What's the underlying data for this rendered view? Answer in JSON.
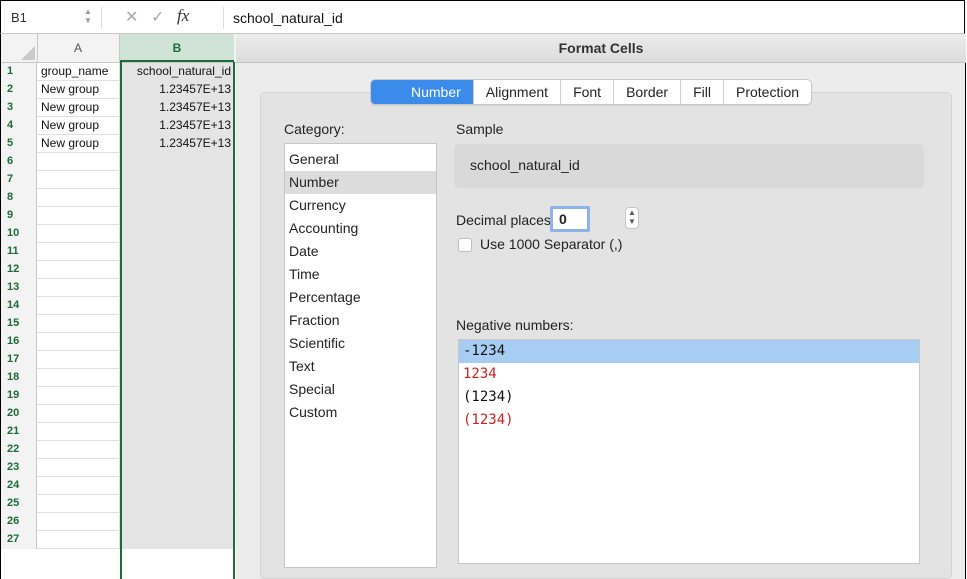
{
  "formula_bar": {
    "name_box": "B1",
    "stepper_glyph": "⌃⌄",
    "cancel_glyph": "✕",
    "accept_glyph": "✓",
    "fx_label": "fx",
    "content": "school_natural_id"
  },
  "sheet": {
    "columns": [
      "A",
      "B"
    ],
    "rows": [
      {
        "num": "1",
        "a": "group_name",
        "b": "school_natural_id"
      },
      {
        "num": "2",
        "a": "New group",
        "b": "1.23457E+13"
      },
      {
        "num": "3",
        "a": "New group",
        "b": "1.23457E+13"
      },
      {
        "num": "4",
        "a": "New group",
        "b": "1.23457E+13"
      },
      {
        "num": "5",
        "a": "New group",
        "b": "1.23457E+13"
      },
      {
        "num": "6",
        "a": "",
        "b": ""
      },
      {
        "num": "7",
        "a": "",
        "b": ""
      },
      {
        "num": "8",
        "a": "",
        "b": ""
      },
      {
        "num": "9",
        "a": "",
        "b": ""
      },
      {
        "num": "10",
        "a": "",
        "b": ""
      },
      {
        "num": "11",
        "a": "",
        "b": ""
      },
      {
        "num": "12",
        "a": "",
        "b": ""
      },
      {
        "num": "13",
        "a": "",
        "b": ""
      },
      {
        "num": "14",
        "a": "",
        "b": ""
      },
      {
        "num": "15",
        "a": "",
        "b": ""
      },
      {
        "num": "16",
        "a": "",
        "b": ""
      },
      {
        "num": "17",
        "a": "",
        "b": ""
      },
      {
        "num": "18",
        "a": "",
        "b": ""
      },
      {
        "num": "19",
        "a": "",
        "b": ""
      },
      {
        "num": "20",
        "a": "",
        "b": ""
      },
      {
        "num": "21",
        "a": "",
        "b": ""
      },
      {
        "num": "22",
        "a": "",
        "b": ""
      },
      {
        "num": "23",
        "a": "",
        "b": ""
      },
      {
        "num": "24",
        "a": "",
        "b": ""
      },
      {
        "num": "25",
        "a": "",
        "b": ""
      },
      {
        "num": "26",
        "a": "",
        "b": ""
      },
      {
        "num": "27",
        "a": "",
        "b": ""
      }
    ]
  },
  "dialog": {
    "title": "Format Cells",
    "tabs": [
      {
        "label": "Number",
        "active": true
      },
      {
        "label": "Alignment",
        "active": false
      },
      {
        "label": "Font",
        "active": false
      },
      {
        "label": "Border",
        "active": false
      },
      {
        "label": "Fill",
        "active": false
      },
      {
        "label": "Protection",
        "active": false
      }
    ],
    "category_label": "Category:",
    "categories": [
      "General",
      "Number",
      "Currency",
      "Accounting",
      "Date",
      "Time",
      "Percentage",
      "Fraction",
      "Scientific",
      "Text",
      "Special",
      "Custom"
    ],
    "selected_category": "Number",
    "sample_label": "Sample",
    "sample_value": "school_natural_id",
    "decimal_label": "Decimal places:",
    "decimal_value": "0",
    "stepper_glyph": "⌃⌄",
    "separator_label": "Use 1000 Separator (,)",
    "separator_checked": false,
    "negative_label": "Negative numbers:",
    "negative_options": [
      {
        "text": "-1234",
        "color": "#111111",
        "selected": true
      },
      {
        "text": "1234",
        "color": "#cc2222",
        "selected": false
      },
      {
        "text": "(1234)",
        "color": "#111111",
        "selected": false
      },
      {
        "text": "(1234)",
        "color": "#cc2222",
        "selected": false
      }
    ]
  }
}
